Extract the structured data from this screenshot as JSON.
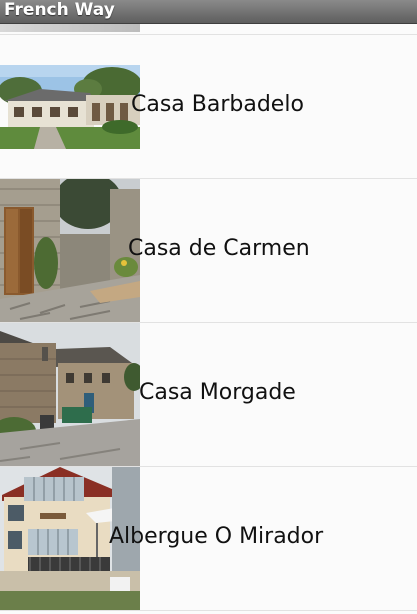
{
  "app": {
    "title": "French Way"
  },
  "list": {
    "items": [
      {
        "label": "Casa Barbadelo",
        "image": "house-photo"
      },
      {
        "label": "Casa de Carmen",
        "image": "stone-doorway-photo"
      },
      {
        "label": "Casa Morgade",
        "image": "village-street-photo"
      },
      {
        "label": "Albergue O Mirador",
        "image": "hostel-building-photo"
      }
    ]
  }
}
